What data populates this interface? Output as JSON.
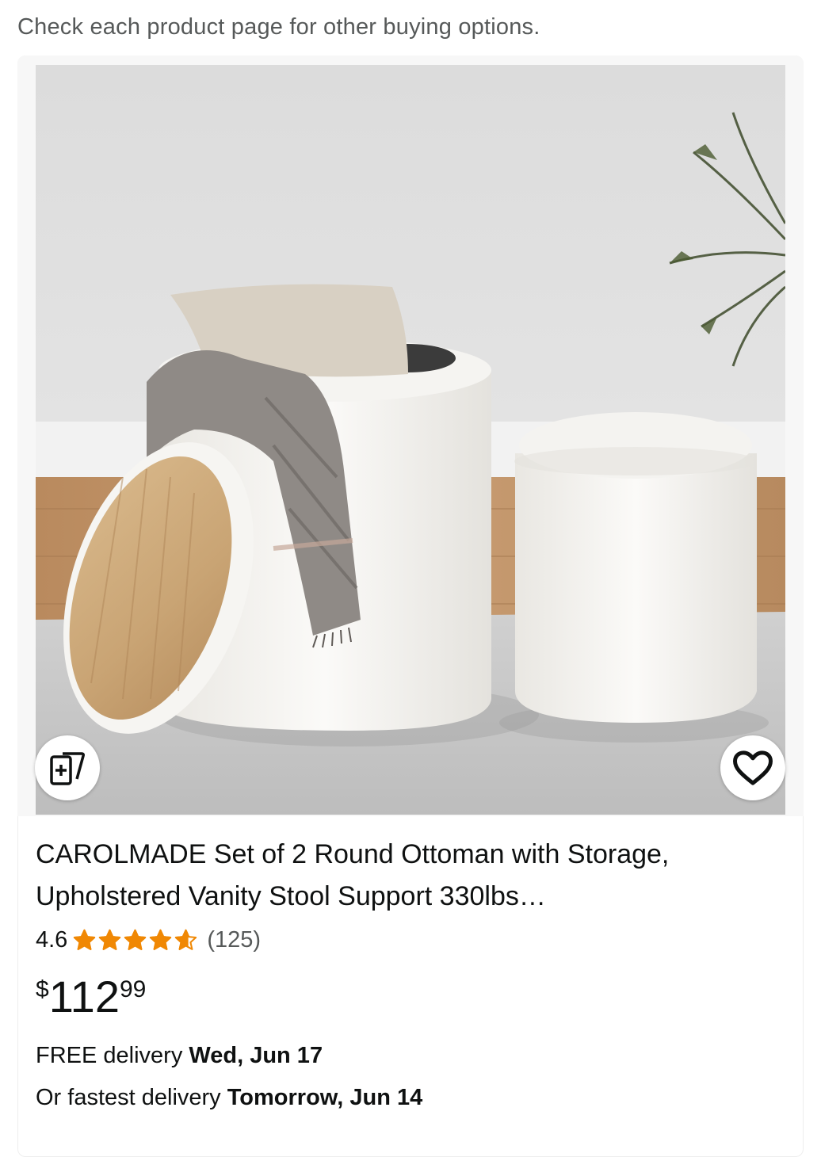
{
  "notice": "Check each product page for other buying options.",
  "product": {
    "title": "CAROLMADE Set of 2 Round Ottoman with Storage, Upholstered Vanity Stool Support 330lbs…",
    "rating": "4.6",
    "stars_value": 4.6,
    "stars_max": 5,
    "review_count": "(125)",
    "price": {
      "symbol": "$",
      "whole": "112",
      "fraction": "99"
    },
    "delivery": {
      "free_prefix": "FREE delivery ",
      "free_date": "Wed, Jun 17",
      "fast_prefix": "Or fastest delivery ",
      "fast_date": "Tomorrow, Jun 14"
    }
  },
  "icons": {
    "compare": "add-to-compare-icon",
    "favorite": "heart-outline-icon",
    "star": "star-icon"
  },
  "colors": {
    "star": "#f08804",
    "text": "#0f1111",
    "muted": "#565959"
  }
}
